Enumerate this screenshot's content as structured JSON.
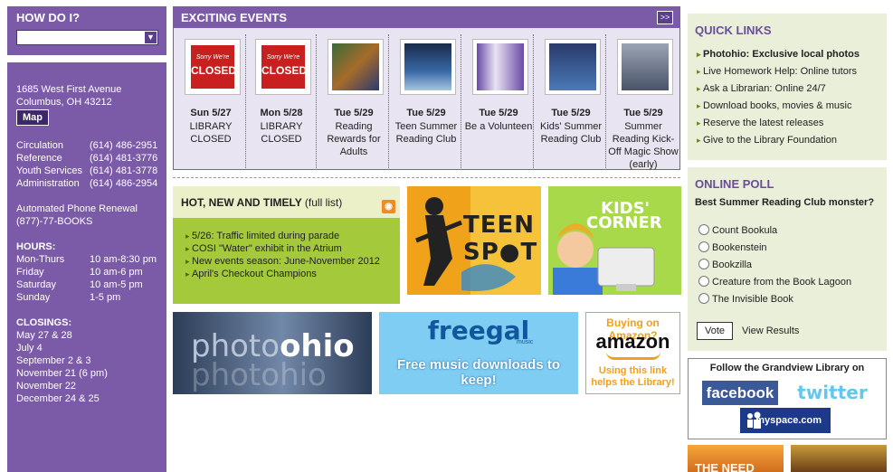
{
  "how_do_i": {
    "title": "HOW DO I?",
    "select_value": ""
  },
  "sidebar": {
    "address1": "1685 West First Avenue",
    "address2": "Columbus, OH 43212",
    "map_label": "Map",
    "phones": [
      {
        "label": "Circulation",
        "number": "(614) 486-2951"
      },
      {
        "label": "Reference",
        "number": "(614) 481-3776"
      },
      {
        "label": "Youth Services",
        "number": "(614) 481-3778"
      },
      {
        "label": "Administration",
        "number": "(614) 486-2954"
      }
    ],
    "renewal1": "Automated Phone Renewal",
    "renewal2": "(877)-77-BOOKS",
    "hours_title": "HOURS:",
    "hours": [
      {
        "days": "Mon-Thurs",
        "time": "10 am-8:30 pm"
      },
      {
        "days": "Friday",
        "time": "10 am-6 pm"
      },
      {
        "days": "Saturday",
        "time": "10 am-5 pm"
      },
      {
        "days": "Sunday",
        "time": "1-5 pm"
      }
    ],
    "closings_title": "CLOSINGS:",
    "closings": [
      "May 27 & 28",
      "July 4",
      "September 2 & 3",
      "November 21 (6 pm)",
      "November 22",
      "December 24 & 25"
    ]
  },
  "events": {
    "title": "EXCITING EVENTS",
    "more_label": ">>",
    "closed_sign": {
      "top": "Sorry We're",
      "main": "CLOSED"
    },
    "items": [
      {
        "date": "Sun 5/27",
        "text": "LIBRARY CLOSED",
        "image": "closed-sign"
      },
      {
        "date": "Mon 5/28",
        "text": "LIBRARY CLOSED",
        "image": "closed-sign"
      },
      {
        "date": "Tue 5/29",
        "text": "Reading Rewards for Adults",
        "image": "between-the-covers"
      },
      {
        "date": "Tue 5/29",
        "text": "Teen Summer Reading Club",
        "image": "own-the-night"
      },
      {
        "date": "Tue 5/29",
        "text": "Be a Volunteen",
        "image": "volunteen-silhouettes"
      },
      {
        "date": "Tue 5/29",
        "text": "Kids' Summer Reading Club",
        "image": "dream-big-read"
      },
      {
        "date": "Tue 5/29",
        "text": "Summer Reading Kick-Off Magic Show (early)",
        "image": "magic-show"
      }
    ]
  },
  "hot": {
    "title": "HOT, NEW AND TIMELY",
    "full_list": "(full list)",
    "items": [
      "5/26: Traffic limited during parade",
      "COSI \"Water\" exhibit in the Atrium",
      "New events season: June-November 2012",
      "April's Checkout Champions"
    ]
  },
  "tiles": {
    "teen_line1": "TEEN",
    "teen_line2": "SP●T",
    "kids_line1": "KIDS'",
    "kids_line2": "CORNER",
    "photohio_a": "photo",
    "photohio_b": "ohio",
    "photohio_reflect": "photohio",
    "freegal_logo": "freegal",
    "freegal_music": "music",
    "freegal_tag": "Free music downloads to keep!",
    "amazon_q": "Buying on Amazon?",
    "amazon_logo": "amazon",
    "amazon_tag": "Using this link helps the Library!"
  },
  "quick_links": {
    "title": "QUICK LINKS",
    "items": [
      "Photohio: Exclusive local photos",
      "Live Homework Help: Online tutors",
      "Ask a Librarian: Online 24/7",
      "Download books, movies & music",
      "Reserve the latest releases",
      "Give to the Library Foundation"
    ]
  },
  "poll": {
    "title": "ONLINE POLL",
    "question": "Best Summer Reading Club monster?",
    "options": [
      "Count Bookula",
      "Bookenstein",
      "Bookzilla",
      "Creature from the Book Lagoon",
      "The Invisible Book"
    ],
    "vote_label": "Vote",
    "results_label": "View Results"
  },
  "follow": {
    "title": "Follow the Grandview Library on",
    "facebook": "facebook",
    "twitter": "twitter",
    "myspace": "myspace",
    "myspace_domain": ".com"
  },
  "bottom": {
    "need_text": "THE NEED"
  },
  "colors": {
    "purple": "#7b5aa7",
    "lime": "#a4c93b",
    "pale_green": "#e9efd9"
  }
}
